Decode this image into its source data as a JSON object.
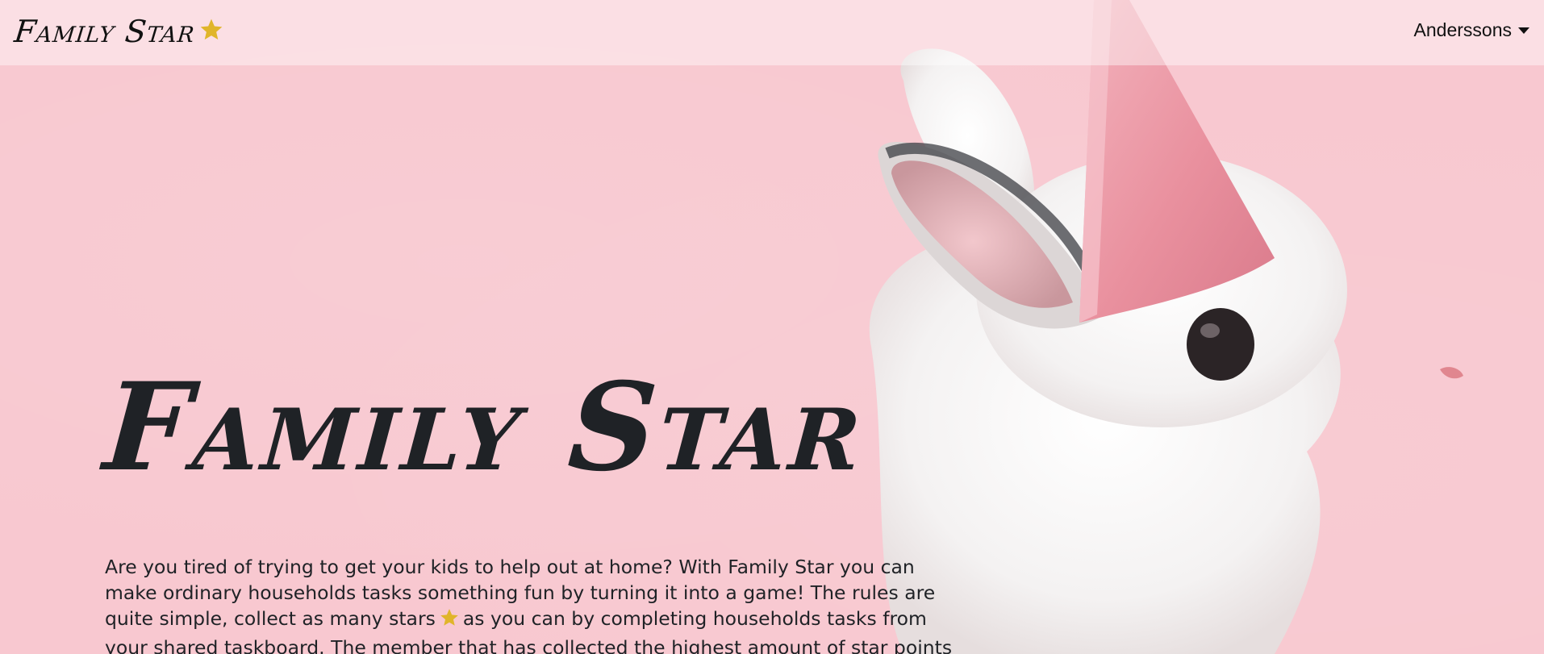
{
  "navbar": {
    "brand": "Family Star",
    "user_menu_label": "Anderssons",
    "icons": {
      "brand_star": "star-icon",
      "user_caret": "caret-down-icon"
    }
  },
  "hero": {
    "title": "Family Star",
    "description_part1": "Are you tired of trying to get your kids to help out at home? With Family Star you can make ordinary households tasks something fun by turning it into a game! The rules are quite simple, collect as many stars",
    "description_part2": "as you can by completing households tasks from your shared taskboard. The member that has collected the highest amount of star points is the Family Star."
  },
  "colors": {
    "background": "#f8c8d0",
    "star": "#e0b52a",
    "text": "#1f2226",
    "navbar_overlay": "rgba(255,255,255,0.42)"
  }
}
